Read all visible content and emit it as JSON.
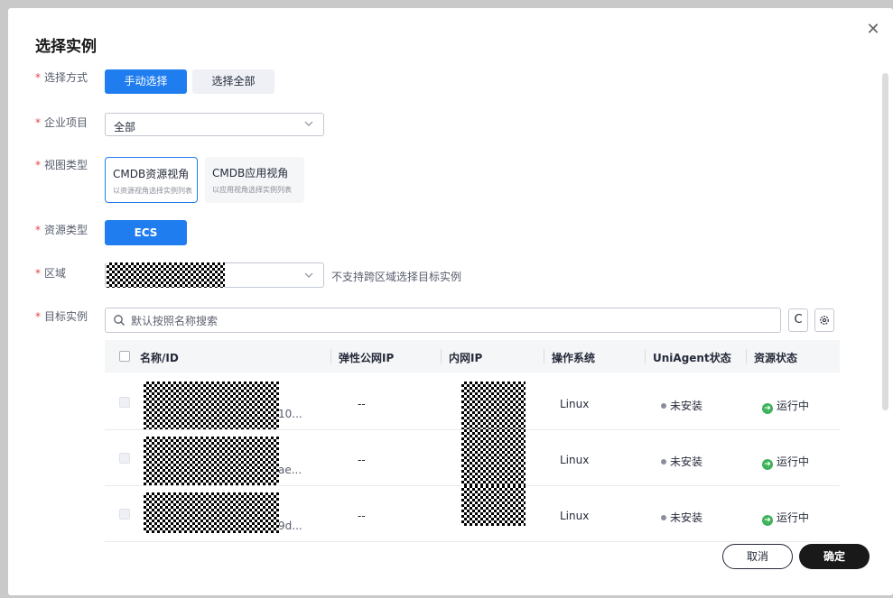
{
  "dialog": {
    "title": "选择实例"
  },
  "form": {
    "selection_mode": {
      "label": "选择方式",
      "options": [
        "手动选择",
        "选择全部"
      ],
      "selected": "手动选择"
    },
    "enterprise_project": {
      "label": "企业项目",
      "value": "全部"
    },
    "view_type": {
      "label": "视图类型",
      "options": [
        {
          "title": "CMDB资源视角",
          "subtitle": "以资源视角选择实例列表"
        },
        {
          "title": "CMDB应用视角",
          "subtitle": "以应用视角选择实例列表"
        }
      ],
      "selected": "CMDB资源视角"
    },
    "resource_type": {
      "label": "资源类型",
      "value": "ECS"
    },
    "region": {
      "label": "区域",
      "hint": "不支持跨区域选择目标实例"
    },
    "target_instances": {
      "label": "目标实例"
    }
  },
  "search": {
    "placeholder": "默认按照名称搜索",
    "value": ""
  },
  "toolbar": {
    "refresh_icon": "C",
    "settings_icon": "gear-icon"
  },
  "table": {
    "columns": [
      "名称/ID",
      "弹性公网IP",
      "内网IP",
      "操作系统",
      "UniAgent状态",
      "资源状态"
    ],
    "rows": [
      {
        "name_suffix": "10...",
        "eip": "--",
        "os": "Linux",
        "agent_status": "未安装",
        "resource_status": "运行中"
      },
      {
        "name_suffix": "ae...",
        "eip": "--",
        "os": "Linux",
        "agent_status": "未安装",
        "resource_status": "运行中"
      },
      {
        "name_suffix": "9d...",
        "eip": "--",
        "os": "Linux",
        "agent_status": "未安装",
        "resource_status": "运行中"
      }
    ]
  },
  "footer": {
    "cancel_label": "取消",
    "confirm_label": "确定"
  },
  "colors": {
    "primary": "#1f7df0",
    "required": "#e54545",
    "running": "#3fb35c",
    "dark_button": "#191919"
  }
}
